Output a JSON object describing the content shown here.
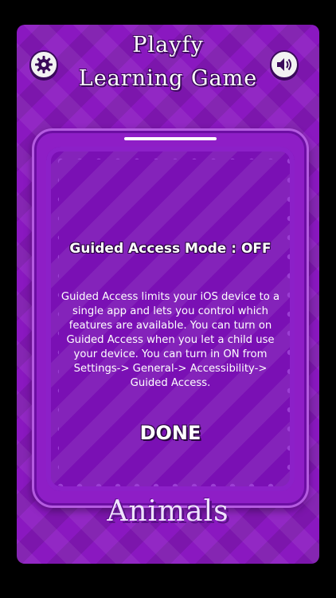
{
  "header": {
    "title_line1": "Playfy",
    "title_line2": "Learning Game",
    "settings_icon": "gear-icon",
    "sound_icon": "speaker-icon"
  },
  "dialog": {
    "title": "Guided Access Mode : OFF",
    "message": "Guided Access limits your iOS device to a single app and lets you control which features are available. You can turn on Guided Access when you let a child use your device. You can turn in ON from Settings-> General-> Accessibility-> Guided Access.",
    "done_label": "DONE"
  },
  "footer": {
    "category_label": "Animals"
  },
  "colors": {
    "background": "#8a18c0",
    "panel": "#7a10b4",
    "text": "#ffffff"
  }
}
